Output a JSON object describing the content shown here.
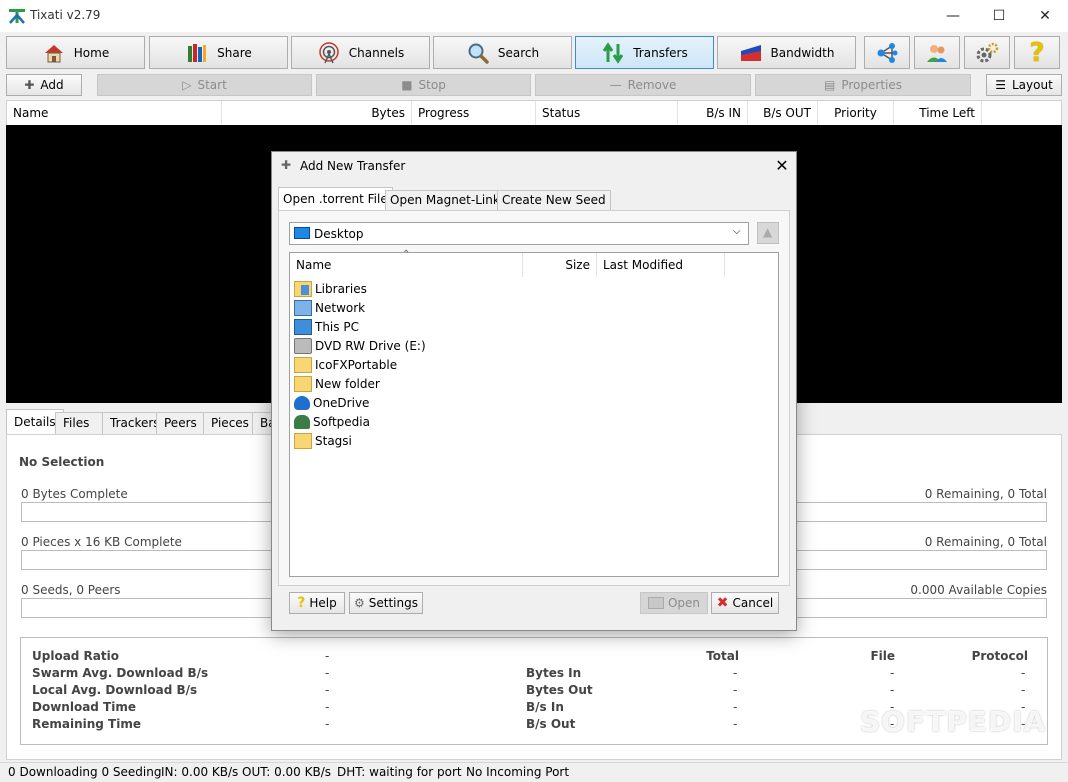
{
  "app": {
    "title": "Tixati v2.79"
  },
  "nav": [
    {
      "label": "Home",
      "icon": "home-icon"
    },
    {
      "label": "Share",
      "icon": "books-icon"
    },
    {
      "label": "Channels",
      "icon": "antenna-icon"
    },
    {
      "label": "Search",
      "icon": "magnifier-icon"
    },
    {
      "label": "Transfers",
      "icon": "transfer-arrows-icon"
    },
    {
      "label": "Bandwidth",
      "icon": "bandwidth-icon"
    }
  ],
  "nav_icons": [
    "network-nodes-icon",
    "users-icon",
    "gears-icon",
    "help-icon"
  ],
  "actions": {
    "add": "Add",
    "start": "Start",
    "stop": "Stop",
    "remove": "Remove",
    "properties": "Properties",
    "layout": "Layout"
  },
  "list_columns": [
    "Name",
    "Bytes",
    "Progress",
    "Status",
    "B/s IN",
    "B/s OUT",
    "Priority",
    "Time Left"
  ],
  "bottom_tabs": [
    "Details",
    "Files",
    "Trackers",
    "Peers",
    "Pieces",
    "Ba"
  ],
  "details": {
    "selection": "No Selection",
    "bytes_complete": "0 Bytes Complete",
    "bytes_remaining": "0 Remaining,  0 Total",
    "pieces_complete": "0 Pieces  x  16 KB Complete",
    "pieces_remaining": "0 Remaining,  0 Total",
    "seeds_peers": "0 Seeds, 0 Peers",
    "available_copies": "0.000 Available Copies"
  },
  "stats": {
    "left_labels": [
      "Upload Ratio",
      "Swarm Avg. Download B/s",
      "Local Avg. Download B/s",
      "Download Time",
      "Remaining Time"
    ],
    "left_values": [
      "-",
      "-",
      "-",
      "-",
      "-"
    ],
    "col_headers": [
      "Total",
      "File",
      "Protocol"
    ],
    "right_labels": [
      "Bytes In",
      "Bytes Out",
      "B/s In",
      "B/s Out"
    ],
    "dash": "-"
  },
  "status_bar": {
    "transfers": "0 Downloading   0 Seeding",
    "in": "IN: 0.00 KB/s",
    "out": "OUT: 0.00 KB/s",
    "dht": "DHT: waiting for port",
    "port": "No Incoming Port"
  },
  "watermark": "SOFTPEDIA",
  "dialog": {
    "title": "Add New Transfer",
    "tabs": [
      "Open .torrent File",
      "Open Magnet-Link",
      "Create New Seed"
    ],
    "folder": "Desktop",
    "columns": [
      "Name",
      "Size",
      "Last Modified"
    ],
    "files": [
      {
        "name": "Libraries",
        "icon": "libraries-icon"
      },
      {
        "name": "Network",
        "icon": "network-icon"
      },
      {
        "name": "This PC",
        "icon": "computer-icon"
      },
      {
        "name": "DVD RW Drive (E:)",
        "icon": "dvd-drive-icon"
      },
      {
        "name": "IcoFXPortable",
        "icon": "folder-icon"
      },
      {
        "name": "New folder",
        "icon": "folder-icon"
      },
      {
        "name": "OneDrive",
        "icon": "cloud-icon"
      },
      {
        "name": "Softpedia",
        "icon": "user-icon"
      },
      {
        "name": "Stagsi",
        "icon": "folder-icon"
      }
    ],
    "buttons": {
      "help": "Help",
      "settings": "Settings",
      "open": "Open",
      "cancel": "Cancel"
    }
  },
  "colors": {
    "accent": "#3c8bd6",
    "list_bg": "#000000",
    "folder": "#f7d673"
  }
}
